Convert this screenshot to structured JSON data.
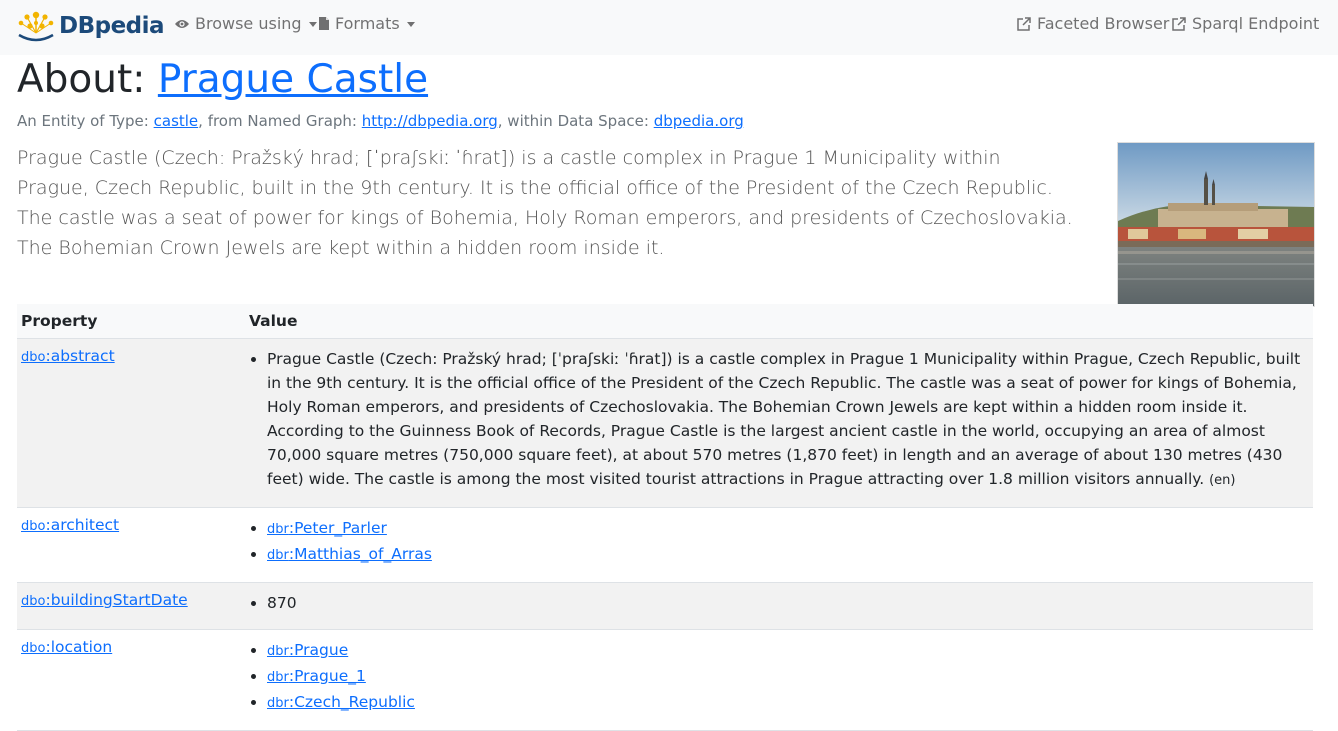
{
  "nav": {
    "brand": "DBpedia",
    "browse_label": "Browse using",
    "formats_label": "Formats",
    "faceted_label": "Faceted Browser",
    "sparql_label": "Sparql Endpoint"
  },
  "title": {
    "prefix": "About:",
    "entity": "Prague Castle"
  },
  "meta": {
    "type_prefix": "An Entity of Type:",
    "type_link": "castle",
    "graph_prefix": ", from Named Graph:",
    "graph_link": "http://dbpedia.org",
    "space_prefix": ", within Data Space:",
    "space_link": "dbpedia.org"
  },
  "lead": "Prague Castle (Czech: Pražský hrad; [ˈpraʃskiː ˈɦrat]) is a castle complex in Prague 1 Municipality within Prague, Czech Republic, built in the 9th century. It is the official office of the President of the Czech Republic. The castle was a seat of power for kings of Bohemia, Holy Roman emperors, and presidents of Czechoslovakia. The Bohemian Crown Jewels are kept within a hidden room inside it.",
  "table": {
    "header_property": "Property",
    "header_value": "Value",
    "rows": [
      {
        "prefix": "dbo",
        "name": ":abstract",
        "abstract": "Prague Castle (Czech: Pražský hrad; [ˈpraʃskiː ˈɦrat]) is a castle complex in Prague 1 Municipality within Prague, Czech Republic, built in the 9th century. It is the official office of the President of the Czech Republic. The castle was a seat of power for kings of Bohemia, Holy Roman emperors, and presidents of Czechoslovakia. The Bohemian Crown Jewels are kept within a hidden room inside it. According to the Guinness Book of Records, Prague Castle is the largest ancient castle in the world, occupying an area of almost 70,000 square metres (750,000 square feet), at about 570 metres (1,870 feet) in length and an average of about 130 metres (430 feet) wide. The castle is among the most visited tourist attractions in Prague attracting over 1.8 million visitors annually.",
        "lang": "(en)"
      },
      {
        "prefix": "dbo",
        "name": ":architect",
        "values": [
          {
            "prefix": "dbr",
            "name": ":Peter_Parler"
          },
          {
            "prefix": "dbr",
            "name": ":Matthias_of_Arras"
          }
        ]
      },
      {
        "prefix": "dbo",
        "name": ":buildingStartDate",
        "literal": "870"
      },
      {
        "prefix": "dbo",
        "name": ":location",
        "values": [
          {
            "prefix": "dbr",
            "name": ":Prague"
          },
          {
            "prefix": "dbr",
            "name": ":Prague_1"
          },
          {
            "prefix": "dbr",
            "name": ":Czech_Republic"
          }
        ]
      }
    ]
  },
  "colors": {
    "link": "#0d6efd",
    "navbar_bg": "#f8f9fa",
    "brand": "#1c4a7a",
    "logo_yellow": "#f2b400"
  },
  "icons": [
    "dbpedia-logo-icon",
    "eye-icon",
    "file-icon",
    "external-link-icon"
  ]
}
